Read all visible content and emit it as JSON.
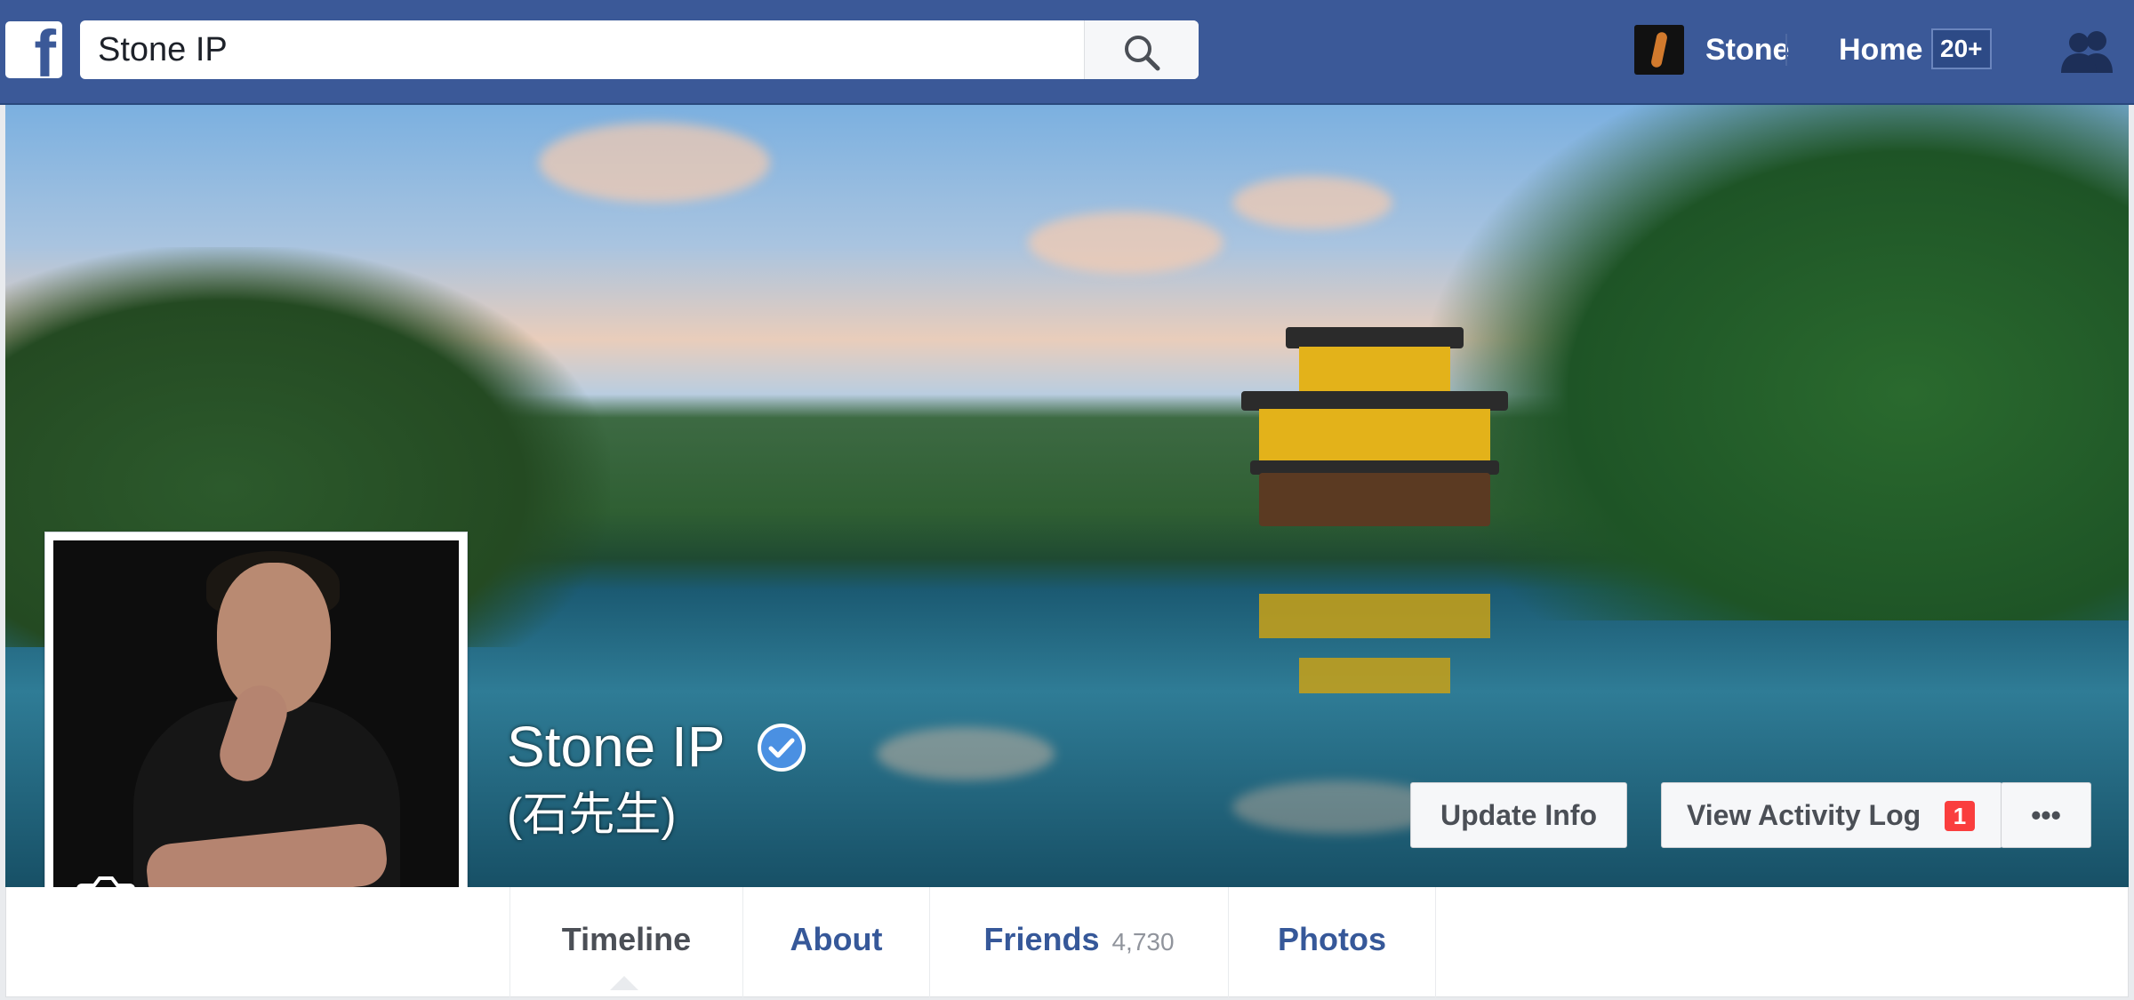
{
  "topbar": {
    "logo_letter": "f",
    "search_value": "Stone IP",
    "user_name": "Stone",
    "home_label": "Home",
    "home_badge": "20+",
    "colors": {
      "bar": "#3b5998",
      "badge": "#2d4a86"
    }
  },
  "profile": {
    "name": "Stone IP",
    "alt_name": "(石先生)",
    "verified": true
  },
  "cover_actions": {
    "update_info": "Update Info",
    "activity_log": "View Activity Log",
    "activity_log_count": "1",
    "more": "•••"
  },
  "tabs": [
    {
      "label": "Timeline",
      "active": true
    },
    {
      "label": "About"
    },
    {
      "label": "Friends",
      "count": "4,730"
    },
    {
      "label": "Photos"
    }
  ],
  "icons": [
    "facebook-logo",
    "search-icon",
    "camera-icon",
    "verified-badge-icon",
    "friend-requests-icon"
  ]
}
